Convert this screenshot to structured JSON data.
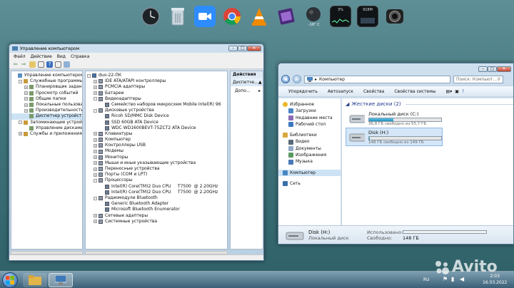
{
  "dock": {
    "items": [
      {
        "name": "clock-widget-icon"
      },
      {
        "name": "recycle-bin-icon"
      },
      {
        "name": "zoom-icon"
      },
      {
        "name": "chrome-icon"
      },
      {
        "name": "vlc-icon"
      },
      {
        "name": "media-player-icon"
      },
      {
        "name": "weather-widget-icon",
        "label": "-16° C"
      },
      {
        "name": "cpu-meter-icon",
        "label": "3%"
      },
      {
        "name": "ram-meter-icon",
        "label": "918M"
      },
      {
        "name": "camera-icon"
      }
    ]
  },
  "mmc": {
    "title": "Управление компьютером",
    "menu": [
      "Файл",
      "Действие",
      "Вид",
      "Справка"
    ],
    "left_tree": [
      {
        "label": "Управление компьютером (л",
        "level": 0,
        "expander": "",
        "selected": false
      },
      {
        "label": "Служебные программы",
        "level": 1,
        "expander": "-",
        "selected": false
      },
      {
        "label": "Планировщик заданий",
        "level": 2,
        "expander": "+",
        "selected": false
      },
      {
        "label": "Просмотр событий",
        "level": 2,
        "expander": "+",
        "selected": false
      },
      {
        "label": "Общие папки",
        "level": 2,
        "expander": "+",
        "selected": false
      },
      {
        "label": "Локальные пользоват",
        "level": 2,
        "expander": "+",
        "selected": false
      },
      {
        "label": "Производительность",
        "level": 2,
        "expander": "+",
        "selected": false
      },
      {
        "label": "Диспетчер устройств",
        "level": 2,
        "expander": "",
        "selected": true
      },
      {
        "label": "Запоминающие устройст",
        "level": 1,
        "expander": "-",
        "selected": false
      },
      {
        "label": "Управление дисками",
        "level": 2,
        "expander": "",
        "selected": false
      },
      {
        "label": "Службы и приложения",
        "level": 1,
        "expander": "+",
        "selected": false
      }
    ],
    "device_tree": [
      {
        "label": "duo-22-ПК",
        "level": 0,
        "expander": "-"
      },
      {
        "label": "IDE ATA/ATAPI контроллеры",
        "level": 1,
        "expander": "+"
      },
      {
        "label": "PCMCIA адаптеры",
        "level": 1,
        "expander": "+"
      },
      {
        "label": "Батареи",
        "level": 1,
        "expander": "+"
      },
      {
        "label": "Видеоадаптеры",
        "level": 1,
        "expander": "-"
      },
      {
        "label": "Семейство наборов микросхем Mobile Intel(R) 96",
        "level": 2,
        "expander": ""
      },
      {
        "label": "Дисковые устройства",
        "level": 1,
        "expander": "-"
      },
      {
        "label": "Ricoh SD/MMC Disk Device",
        "level": 2,
        "expander": ""
      },
      {
        "label": "SSD 60GB ATA Device",
        "level": 2,
        "expander": ""
      },
      {
        "label": "WDC WD1600BEVT-75ZCT2 ATA Device",
        "level": 2,
        "expander": ""
      },
      {
        "label": "Клавиатуры",
        "level": 1,
        "expander": "+"
      },
      {
        "label": "Компьютер",
        "level": 1,
        "expander": "+"
      },
      {
        "label": "Контроллеры USB",
        "level": 1,
        "expander": "+"
      },
      {
        "label": "Модемы",
        "level": 1,
        "expander": "+"
      },
      {
        "label": "Мониторы",
        "level": 1,
        "expander": "+"
      },
      {
        "label": "Мыши и иные указывающие устройства",
        "level": 1,
        "expander": "+"
      },
      {
        "label": "Переносные устройства",
        "level": 1,
        "expander": "+"
      },
      {
        "label": "Порты (COM и LPT)",
        "level": 1,
        "expander": "+"
      },
      {
        "label": "Процессоры",
        "level": 1,
        "expander": "-"
      },
      {
        "label": "Intel(R) Core(TM)2 Duo CPU     T7500  @ 2.20GHz",
        "level": 2,
        "expander": ""
      },
      {
        "label": "Intel(R) Core(TM)2 Duo CPU     T7500  @ 2.20GHz",
        "level": 2,
        "expander": ""
      },
      {
        "label": "Радиомодули Bluetooth",
        "level": 1,
        "expander": "-"
      },
      {
        "label": "Generic Bluetooth Adapter",
        "level": 2,
        "expander": ""
      },
      {
        "label": "Microsoft Bluetooth Enumerator",
        "level": 2,
        "expander": ""
      },
      {
        "label": "Сетевые адаптеры",
        "level": 1,
        "expander": "+"
      },
      {
        "label": "Системные устройства",
        "level": 1,
        "expander": "+"
      }
    ],
    "actions": {
      "title": "Действия",
      "sub": "Диспетче...",
      "more": "Допо..."
    }
  },
  "explorer": {
    "address": "Компьютер",
    "search_placeholder": "Поиск: Компьют...",
    "commands": [
      "Упорядочить",
      "Автозапуск",
      "Свойства",
      "Свойства системы"
    ],
    "nav": [
      {
        "label": "Избранное",
        "level": 0,
        "icon": "star-icon",
        "gap": false
      },
      {
        "label": "Загрузки",
        "level": 1,
        "icon": "downloads-icon",
        "gap": false
      },
      {
        "label": "Недавние места",
        "level": 1,
        "icon": "recent-places-icon",
        "gap": false
      },
      {
        "label": "Рабочий стол",
        "level": 1,
        "icon": "desktop-icon",
        "gap": false
      },
      {
        "label": "Библиотеки",
        "level": 0,
        "icon": "libraries-icon",
        "gap": true
      },
      {
        "label": "Видео",
        "level": 1,
        "icon": "video-icon",
        "gap": false
      },
      {
        "label": "Документы",
        "level": 1,
        "icon": "documents-icon",
        "gap": false
      },
      {
        "label": "Изображения",
        "level": 1,
        "icon": "pictures-icon",
        "gap": false
      },
      {
        "label": "Музыка",
        "level": 1,
        "icon": "music-icon",
        "gap": false
      },
      {
        "label": "Компьютер",
        "level": 0,
        "icon": "computer-icon",
        "gap": true,
        "selected": true
      },
      {
        "label": "Сеть",
        "level": 0,
        "icon": "network-icon",
        "gap": true
      }
    ],
    "section_title": "Жесткие диски (2)",
    "drives": [
      {
        "name": "Локальный диск (C:)",
        "free": "36,8 ГБ свободно из 55,7 ГБ",
        "used_fraction": 0.34,
        "selected": false
      },
      {
        "name": "Disk (H:)",
        "free": "148 ГБ свободно из 149 ГБ",
        "used_fraction": 0.01,
        "selected": true
      }
    ],
    "details": {
      "name": "Disk (H:)",
      "type": "Локальный диск",
      "used_label": "Использовано:",
      "free_label": "Свободно:",
      "free_value": "148 ГБ"
    }
  },
  "taskbar": {
    "lang": "RU",
    "time": "2:03",
    "date": "16.03.2022",
    "watermark": "Avito"
  }
}
